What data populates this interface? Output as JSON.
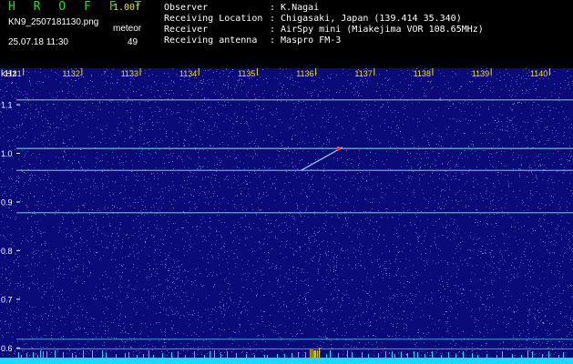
{
  "header": {
    "app_name": "H R O F F T",
    "version": "1.00f",
    "file_name": "KN9_2507181130.png",
    "date_time": "25.07.18 11:30",
    "event_label": "meteor",
    "event_count": "49"
  },
  "info": [
    {
      "key": "Observer",
      "value": ": K.Nagai"
    },
    {
      "key": "Receiving Location",
      "value": ": Chigasaki, Japan (139.414 35.340)"
    },
    {
      "key": "Receiver",
      "value": ": AirSpy mini (Miakejima VOR 108.65MHz)"
    },
    {
      "key": "Receiving antenna",
      "value": ": Maspro FM-3"
    }
  ],
  "spectrogram": {
    "y_unit": "kHz",
    "y_ticks": [
      "1.1",
      "1.0",
      "0.9",
      "0.8",
      "0.7",
      "0.6"
    ],
    "y_range": [
      0.58,
      1.16
    ],
    "x_ticks": [
      "1131",
      "1132",
      "1133",
      "1134",
      "1135",
      "1136",
      "1137",
      "1138",
      "1139",
      "1140"
    ],
    "x_range": [
      1130.6,
      1140.4
    ],
    "carriers_khz": [
      1.11,
      1.01,
      0.965,
      0.878,
      0.618,
      0.598
    ],
    "meteor_trail": {
      "start": [
        1135.75,
        0.965
      ],
      "end": [
        1136.45,
        1.012
      ]
    },
    "colors": {
      "background": "#0a0a78",
      "noise": "#6f6fe0",
      "carrier": "#5cc6c6",
      "tick_label": "#f0e020",
      "axis_label": "#ffffff",
      "floor": "#22d7ff",
      "meteor": "#ff4040"
    }
  }
}
